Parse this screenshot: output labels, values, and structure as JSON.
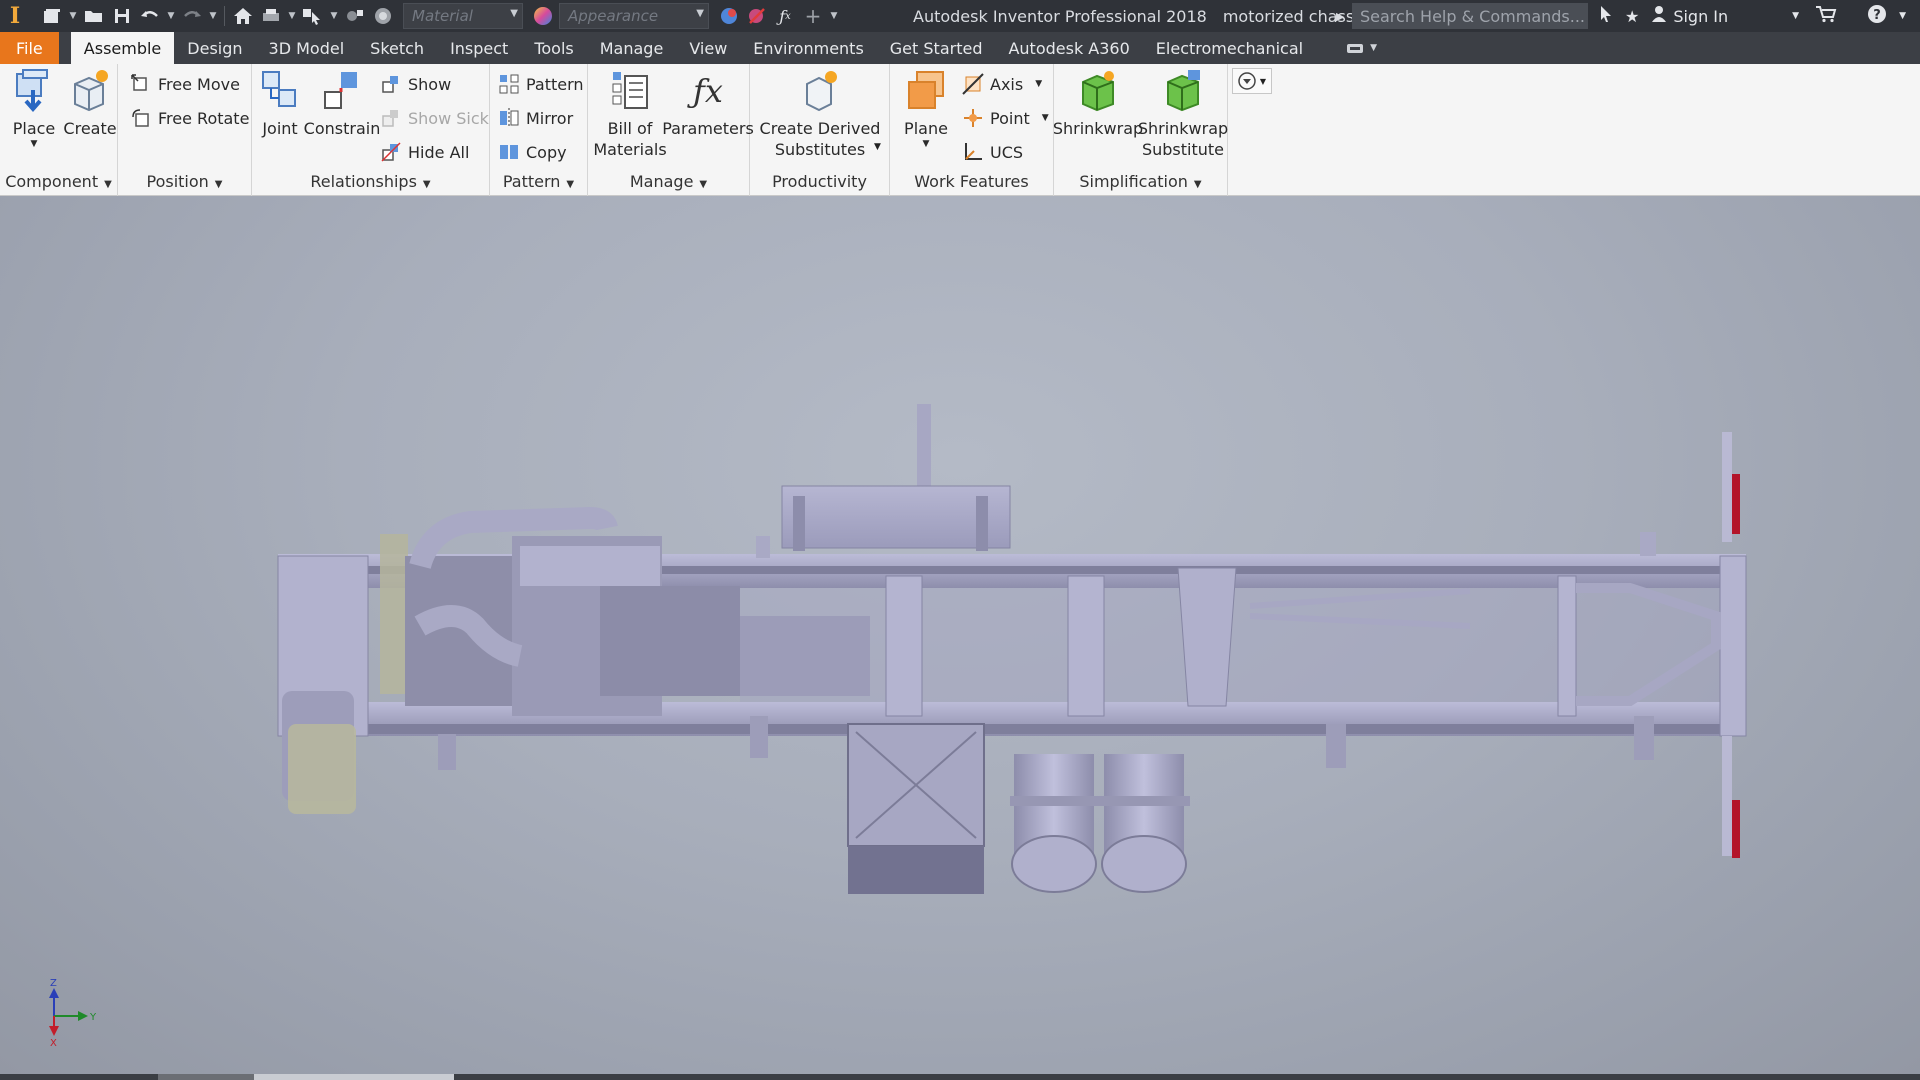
{
  "titlebar": {
    "app_logo": "I",
    "material_placeholder": "Material",
    "appearance_placeholder": "Appearance",
    "app_name": "Autodesk Inventor Professional 2018",
    "document_name": "motorized chassis",
    "search_placeholder": "Search Help & Commands...",
    "sign_in": "Sign In"
  },
  "tabs": [
    {
      "label": "File"
    },
    {
      "label": "Assemble"
    },
    {
      "label": "Design"
    },
    {
      "label": "3D Model"
    },
    {
      "label": "Sketch"
    },
    {
      "label": "Inspect"
    },
    {
      "label": "Tools"
    },
    {
      "label": "Manage"
    },
    {
      "label": "View"
    },
    {
      "label": "Environments"
    },
    {
      "label": "Get Started"
    },
    {
      "label": "Autodesk A360"
    },
    {
      "label": "Electromechanical"
    }
  ],
  "ribbon": {
    "component": {
      "title": "Component",
      "place": "Place",
      "create": "Create"
    },
    "position": {
      "title": "Position",
      "free_move": "Free Move",
      "free_rotate": "Free Rotate"
    },
    "relationships": {
      "title": "Relationships",
      "joint": "Joint",
      "constrain": "Constrain",
      "show": "Show",
      "show_sick": "Show Sick",
      "hide_all": "Hide All"
    },
    "pattern": {
      "title": "Pattern",
      "pattern": "Pattern",
      "mirror": "Mirror",
      "copy": "Copy"
    },
    "manage": {
      "title": "Manage",
      "bom_line1": "Bill of",
      "bom_line2": "Materials",
      "parameters": "Parameters"
    },
    "productivity": {
      "title": "Productivity",
      "cds_line1": "Create Derived",
      "cds_line2": "Substitutes"
    },
    "work_features": {
      "title": "Work Features",
      "plane": "Plane",
      "axis": "Axis",
      "point": "Point",
      "ucs": "UCS"
    },
    "simplification": {
      "title": "Simplification",
      "shrinkwrap": "Shrinkwrap",
      "sws_line1": "Shrinkwrap",
      "sws_line2": "Substitute"
    }
  },
  "viewport": {
    "triad": {
      "z": "Z",
      "y": "Y",
      "x": "X"
    }
  },
  "colors": {
    "file_tab": "#e8761c",
    "part_color": "#a9a9c6",
    "part_dark": "#7d7d9a",
    "red_reflector": "#b3142a"
  }
}
